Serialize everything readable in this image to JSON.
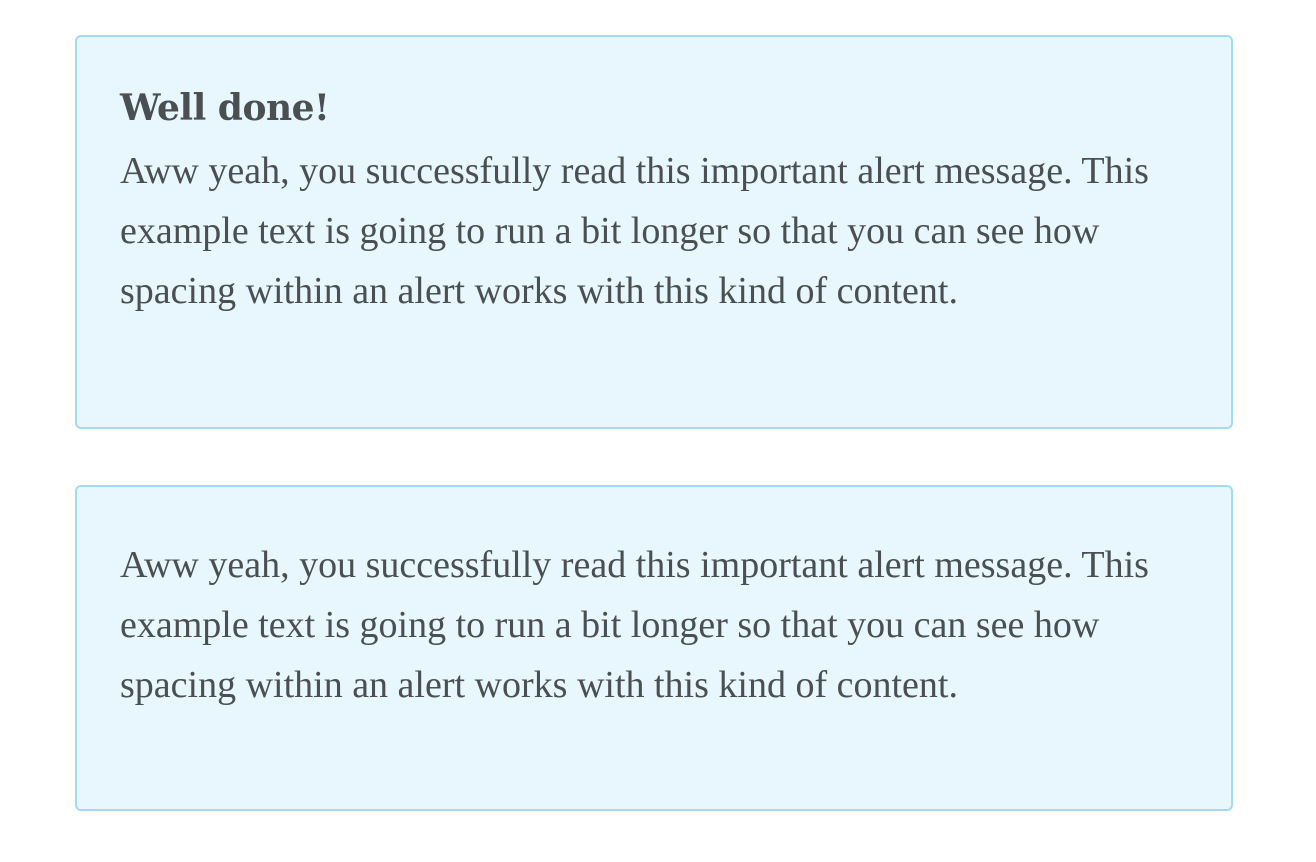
{
  "alerts": [
    {
      "heading": "Well done!",
      "body": "Aww yeah, you successfully read this important alert message. This example text is going to run a bit longer so that you can see how spacing within an alert works with this kind of content."
    },
    {
      "body": "Aww yeah, you successfully read this important alert message. This example text is going to run a bit longer so that you can see how spacing within an alert works with this kind of content."
    }
  ],
  "colors": {
    "alert_background": "#e8f7fe",
    "alert_border": "#a6d9f6",
    "text": "#4a5052"
  }
}
